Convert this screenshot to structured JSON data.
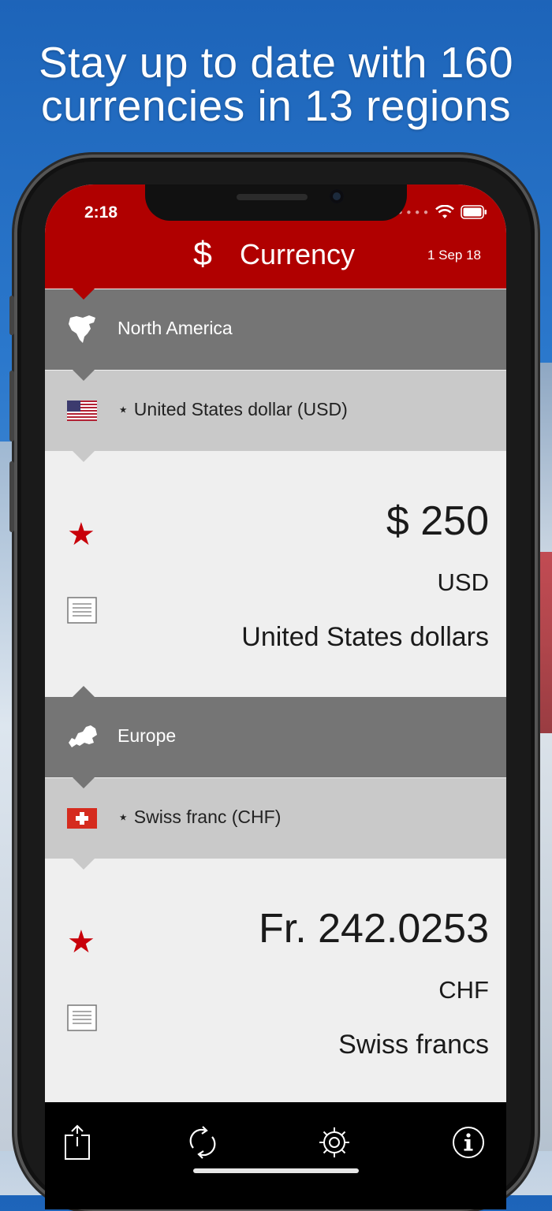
{
  "headline": {
    "line1": "Stay up to date with 160",
    "line2": "currencies in 13 regions"
  },
  "status_bar": {
    "time": "2:18"
  },
  "header": {
    "symbol": "$",
    "title": "Currency",
    "date": "1 Sep 18"
  },
  "sections": [
    {
      "region": "North America",
      "currency_label": "⋆ United States dollar (USD)",
      "amount": "$ 250",
      "code": "USD",
      "name": "United States dollars"
    },
    {
      "region": "Europe",
      "currency_label": "⋆ Swiss franc (CHF)",
      "amount": "Fr. 242.0253",
      "code": "CHF",
      "name": "Swiss francs"
    }
  ],
  "icons": {
    "star": "star-icon",
    "notes": "document-icon",
    "share": "share-icon",
    "refresh": "refresh-icon",
    "settings": "gear-icon",
    "info": "info-icon"
  },
  "colors": {
    "header_red": "#b00000",
    "region_gray": "#757575",
    "currency_gray": "#c9c9c9",
    "star_red": "#c8000a"
  }
}
